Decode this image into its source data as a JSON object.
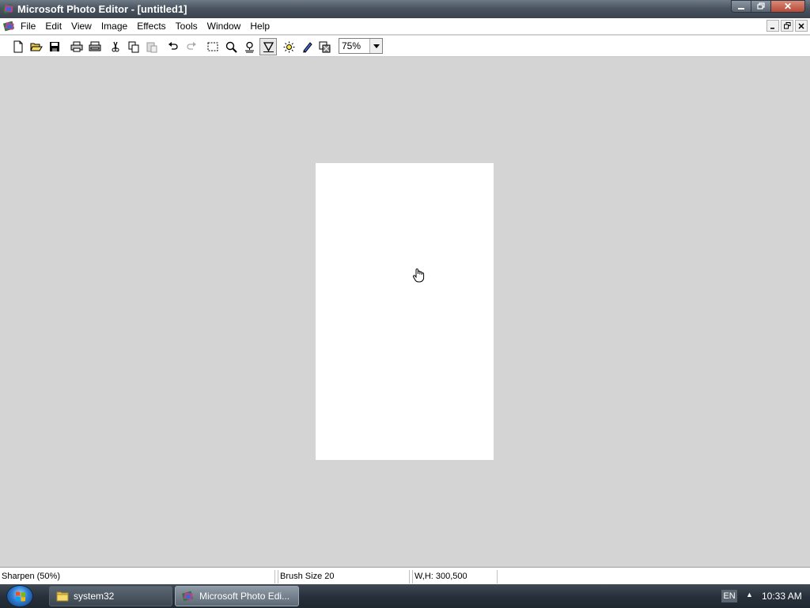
{
  "window": {
    "title": "Microsoft Photo Editor - [untitled1]",
    "controls": [
      "minimize",
      "maximize",
      "close"
    ],
    "close_glyph": "✕"
  },
  "menubar": {
    "items": [
      {
        "label": "File"
      },
      {
        "label": "Edit"
      },
      {
        "label": "View"
      },
      {
        "label": "Image"
      },
      {
        "label": "Effects"
      },
      {
        "label": "Tools"
      },
      {
        "label": "Window"
      },
      {
        "label": "Help"
      }
    ]
  },
  "toolbar": {
    "buttons": [
      "new-icon",
      "open-icon",
      "save-icon",
      "print-icon",
      "scan-icon",
      "cut-icon",
      "copy-icon",
      "paste-icon",
      "undo-icon",
      "redo-icon",
      "select-icon",
      "zoom-icon",
      "smudge-icon",
      "sharpen-icon",
      "sun-icon",
      "pen-icon",
      "transparency-icon"
    ],
    "pressed": "sharpen-icon",
    "zoom_value": "75%"
  },
  "canvas": {
    "color": "#ffffff"
  },
  "statusbar": {
    "tool_status": "Sharpen (50%)",
    "brush_size": "Brush Size 20",
    "dimensions": "W,H: 300,500"
  },
  "taskbar": {
    "tasks": [
      {
        "label": "system32",
        "icon": "folder-icon",
        "active": false
      },
      {
        "label": "Microsoft Photo Edi...",
        "icon": "photo-editor-icon",
        "active": true
      }
    ],
    "language": "EN",
    "clock": "10:33 AM"
  },
  "colors": {
    "workspace": "#d4d4d4",
    "titlebar": "#4a5561",
    "taskbar": "#28313b"
  }
}
